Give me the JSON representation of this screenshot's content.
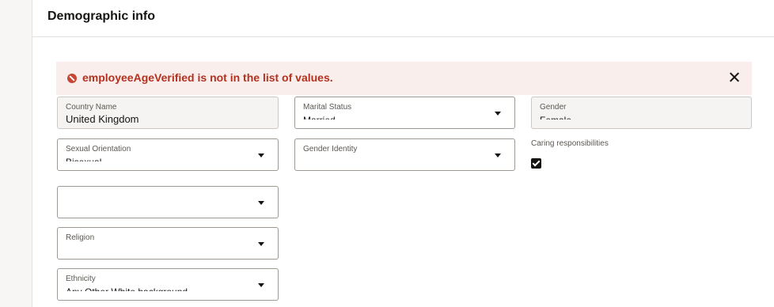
{
  "page": {
    "title": "Demographic info"
  },
  "error": {
    "message": "employeeAgeVerified is not in the list of values."
  },
  "fields": {
    "country": {
      "label": "Country Name",
      "value": "United Kingdom"
    },
    "marital": {
      "label": "Marital Status",
      "value": "Married"
    },
    "gender": {
      "label": "Gender",
      "value": "Female"
    },
    "sexual_orientation": {
      "label": "Sexual Orientation",
      "value": "Bisexual"
    },
    "gender_identity": {
      "label": "Gender Identity",
      "value": ""
    },
    "redacted_field": {
      "label": "",
      "value": ""
    },
    "religion": {
      "label": "Religion",
      "value": ""
    },
    "ethnicity": {
      "label": "Ethnicity",
      "value": "Any Other White background"
    }
  },
  "caring": {
    "label": "Caring responsibilities",
    "checked": true
  }
}
